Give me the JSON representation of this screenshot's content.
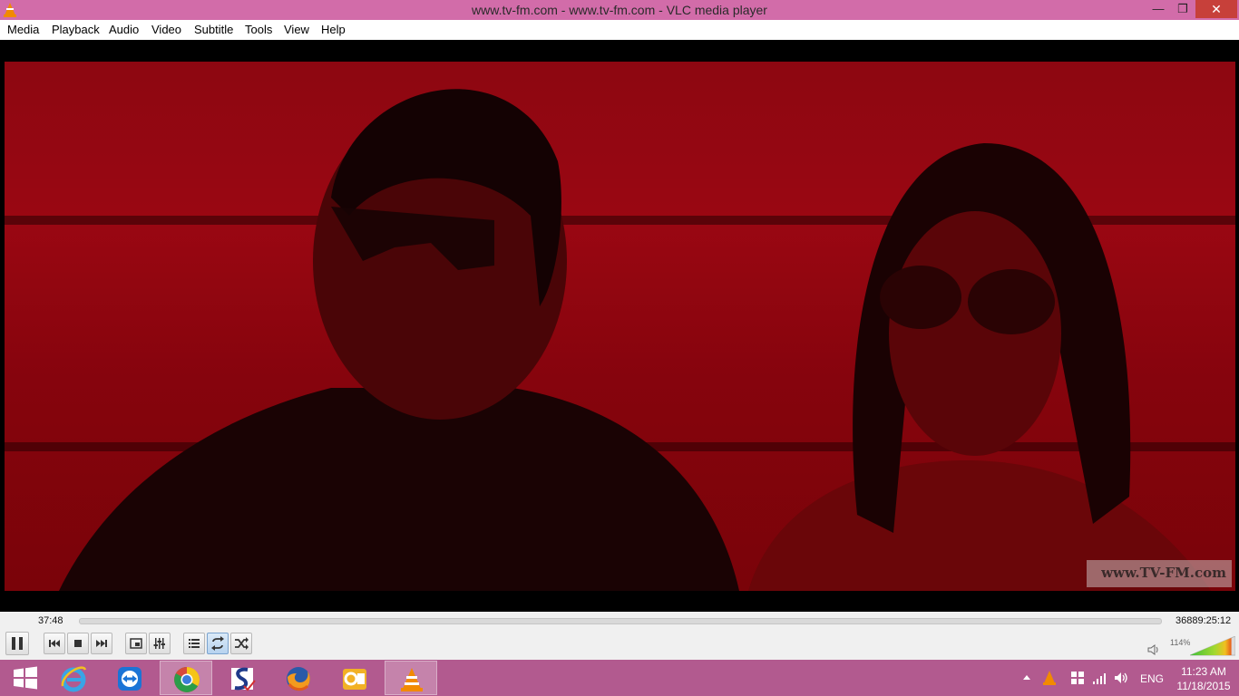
{
  "window": {
    "title": "www.tv-fm.com - www.tv-fm.com - VLC media player"
  },
  "menu": [
    "Media",
    "Playback",
    "Audio",
    "Video",
    "Subtitle",
    "Tools",
    "View",
    "Help"
  ],
  "video": {
    "watermark": "www.TV-FM.com"
  },
  "playback": {
    "elapsed": "37:48",
    "total": "36889:25:12",
    "progress_fraction": 0.0
  },
  "volume": {
    "label": "114%",
    "level_percent": 114
  },
  "taskbar": {
    "apps": [
      "windows-start",
      "internet-explorer",
      "teamviewer",
      "chrome",
      "sigil-app",
      "firefox",
      "outlook",
      "vlc"
    ]
  },
  "tray": {
    "language": "ENG",
    "time": "11:23 AM",
    "date": "11/18/2015"
  },
  "colors": {
    "titlebar": "#d26ca9",
    "taskbar": "#b25a8f",
    "close": "#c7403a"
  }
}
